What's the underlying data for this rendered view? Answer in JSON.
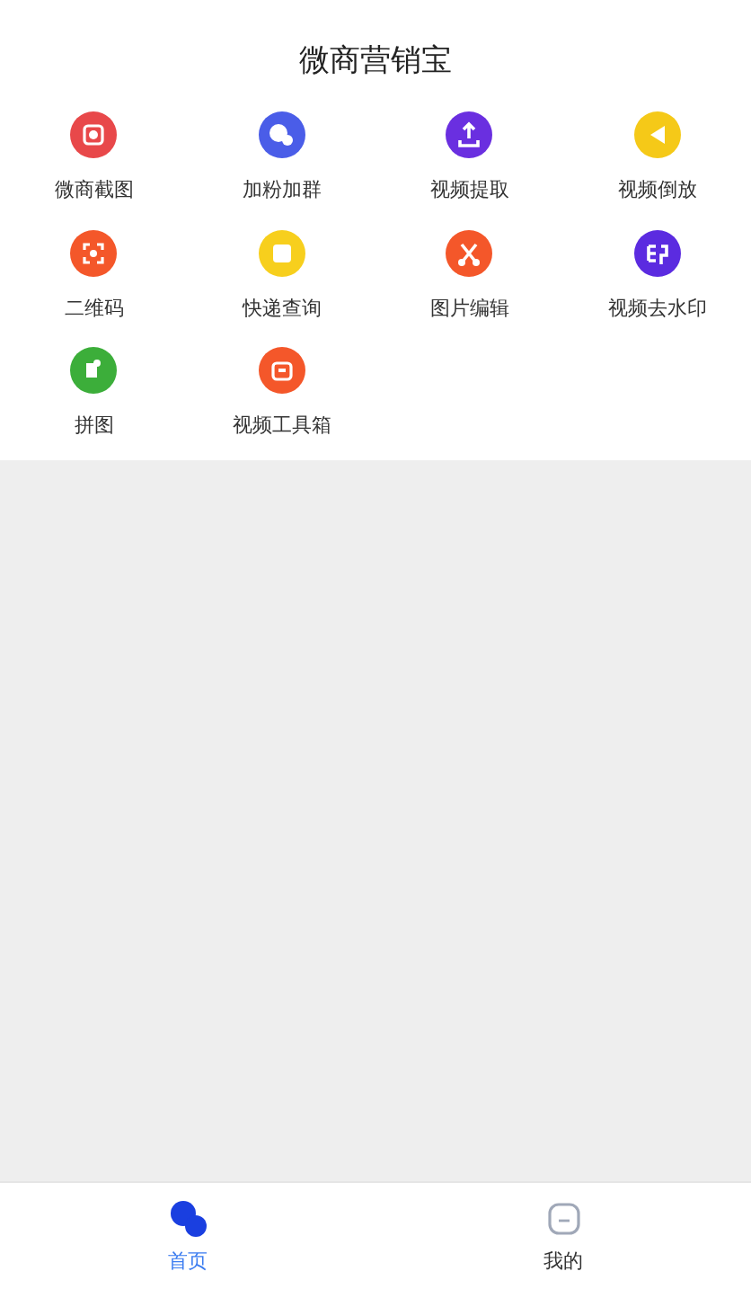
{
  "header": {
    "title": "微商营销宝"
  },
  "tools": [
    {
      "label": "微商截图",
      "color": "#e8484a"
    },
    {
      "label": "加粉加群",
      "color": "#4a5de8"
    },
    {
      "label": "视频提取",
      "color": "#6a2fe0"
    },
    {
      "label": "视频倒放",
      "color": "#f5c918"
    },
    {
      "label": "二维码",
      "color": "#f4572a"
    },
    {
      "label": "快递查询",
      "color": "#f7cf1d"
    },
    {
      "label": "图片编辑",
      "color": "#f4572a"
    },
    {
      "label": "视频去水印",
      "color": "#5b2be0"
    },
    {
      "label": "拼图",
      "color": "#3cae3a"
    },
    {
      "label": "视频工具箱",
      "color": "#f4572a"
    }
  ],
  "tab_bar": [
    {
      "label": "首页",
      "selected": true
    },
    {
      "label": "我的",
      "selected": false
    }
  ]
}
